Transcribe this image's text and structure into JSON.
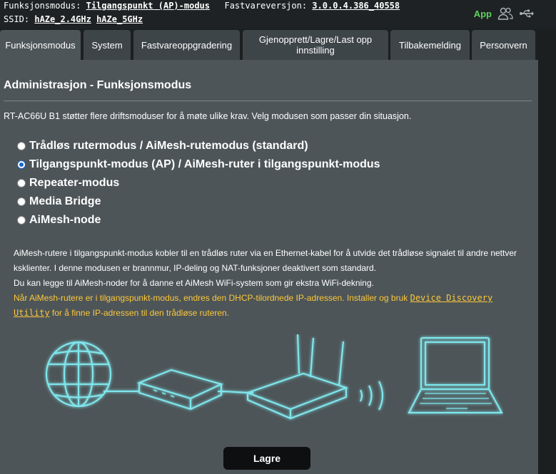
{
  "header": {
    "mode_label": "Funksjonsmodus:",
    "mode_value": "Tilgangspunkt (AP)-modus",
    "fw_label": "Fastvareversjon:",
    "fw_value": "3.0.0.4.386_40558",
    "ssid_label": "SSID:",
    "ssid_24": "hAZe_2.4GHz",
    "ssid_5": "hAZe_5GHz",
    "app_label": "App",
    "icons": [
      "users-icon",
      "usb-icon"
    ]
  },
  "tabs": [
    {
      "label": "Funksjonsmodus",
      "active": true
    },
    {
      "label": "System"
    },
    {
      "label": "Fastvareoppgradering"
    },
    {
      "label": "Gjenopprett/Lagre/Last opp innstilling"
    },
    {
      "label": "Tilbakemelding"
    },
    {
      "label": "Personvern"
    }
  ],
  "page": {
    "title": "Administrasjon - Funksjonsmodus",
    "description": "RT-AC66U B1 støtter flere driftsmoduser for å møte ulike krav. Velg modusen som passer din situasjon."
  },
  "modes": [
    {
      "label": "Trådløs rutermodus / AiMesh-rutemodus (standard)",
      "checked": false
    },
    {
      "label": "Tilgangspunkt-modus (AP) / AiMesh-ruter i tilgangspunkt-modus",
      "checked": true
    },
    {
      "label": "Repeater-modus",
      "checked": false
    },
    {
      "label": "Media Bridge",
      "checked": false
    },
    {
      "label": "AiMesh-node",
      "checked": false
    }
  ],
  "notes": {
    "white_1": "AiMesh-rutere i tilgangspunkt-modus kobler til en trådløs ruter via en Ethernet-kabel for å utvide det trådløse signalet til andre nettver ksklienter. I denne modusen er brannmur, IP-deling og NAT-funksjoner deaktivert som standard.",
    "white_2": "Du kan legge til AiMesh-noder for å danne et AiMesh WiFi-system som gir ekstra WiFi-dekning.",
    "yellow_pre": "Når AiMesh-rutere er i tilgangspunkt-modus, endres den DHCP-tilordnede IP-adressen. Installer og bruk ",
    "yellow_link": "Device Discovery Utility",
    "yellow_post": " for å finne IP-adressen til den trådløse ruteren."
  },
  "illustration": {
    "icons": [
      "globe-icon",
      "modem-icon",
      "router-icon",
      "wifi-waves-icon",
      "laptop-icon"
    ],
    "glow_color": "#7fe6ec"
  },
  "actions": {
    "save_label": "Lagre"
  },
  "colors": {
    "panel": "#4d5558",
    "tab": "#3e4549",
    "note_yellow": "#fdc73a",
    "app_green": "#5cd35c"
  }
}
